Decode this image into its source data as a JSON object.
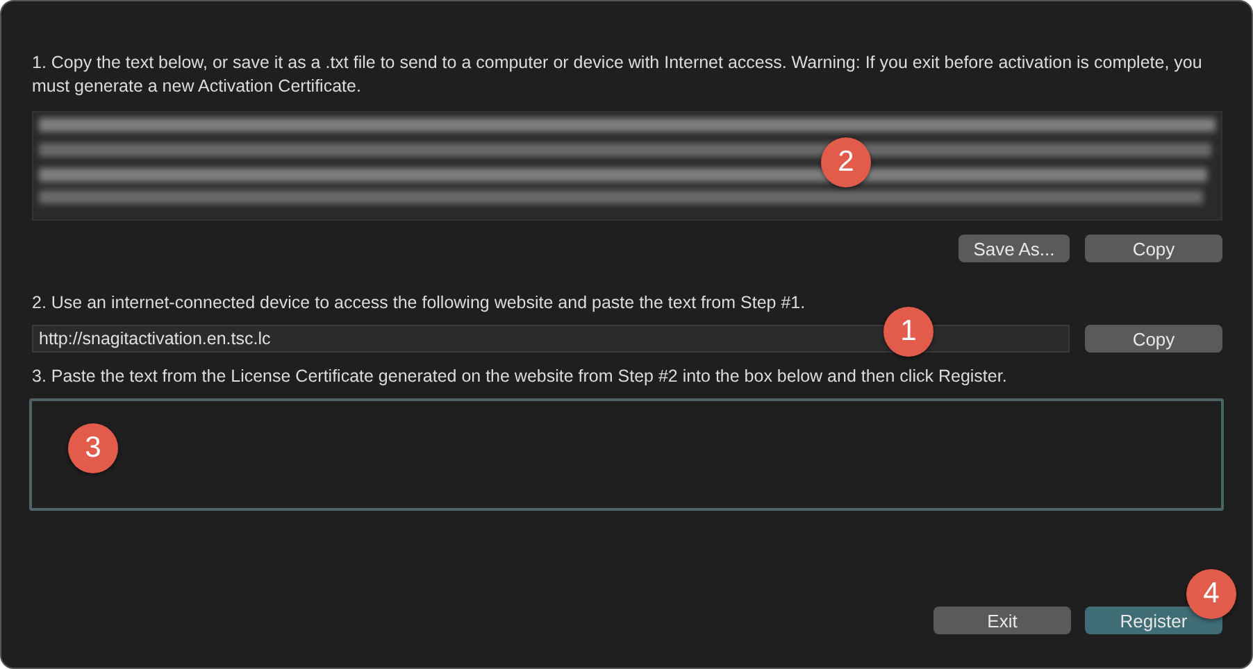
{
  "step1": {
    "instruction": "1. Copy the text below, or save it as a .txt file to send to a computer or device with Internet access. Warning: If you exit before activation is complete, you must generate a new Activation Certificate.",
    "buttons": [
      "Save As...",
      "Copy"
    ]
  },
  "step2": {
    "instruction": "2. Use an internet-connected device to access the following website and paste the text from Step #1.",
    "url": "http://snagitactivation.en.tsc.lc",
    "button": "Copy"
  },
  "step3": {
    "instruction": "3. Paste the text from the License Certificate generated on the website from Step #2 into the box below and then click Register."
  },
  "footer_buttons": [
    {
      "label": "Exit",
      "kind": "normal"
    },
    {
      "label": "Register",
      "kind": "primary"
    }
  ],
  "callouts": [
    {
      "label": "2",
      "kind": "certificate"
    },
    {
      "label": "1",
      "kind": "url"
    },
    {
      "label": "3",
      "kind": "license"
    },
    {
      "label": "4",
      "kind": "register"
    }
  ]
}
